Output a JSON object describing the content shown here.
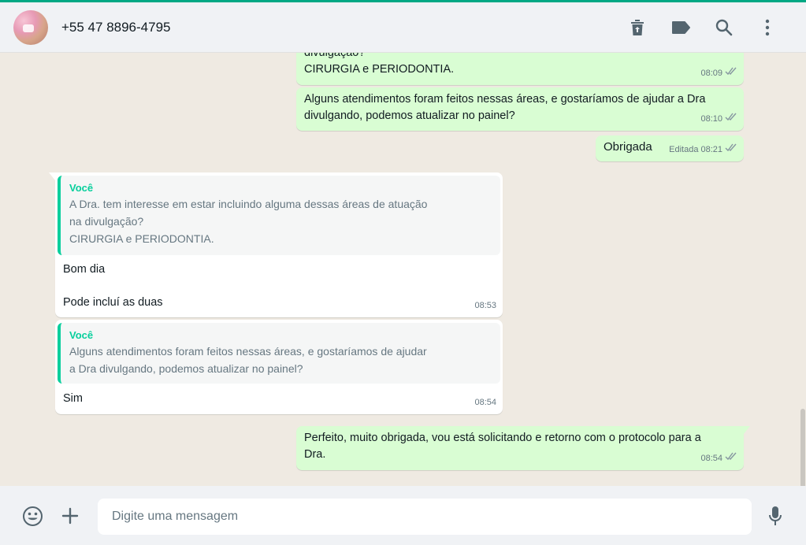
{
  "header": {
    "contact_name": "+55 47 8896-4795",
    "icons": [
      "delete-icon",
      "label-icon",
      "search-icon",
      "menu-icon"
    ]
  },
  "messages": {
    "m1": {
      "lines": [
        "divulgação?",
        "CIRURGIA e PERIODONTIA."
      ],
      "time": "08:09"
    },
    "m2": {
      "lines": [
        "Alguns atendimentos foram feitos nessas áreas, e gostaríamos de ajudar a Dra",
        "divulgando, podemos atualizar no painel?"
      ],
      "time": "08:10"
    },
    "m3": {
      "text": "Obrigada",
      "edited": "Editada",
      "time": "08:21"
    },
    "m4": {
      "quote_author": "Você",
      "quote_lines": [
        "A Dra. tem interesse em estar incluindo alguma dessas áreas de atuação",
        "na divulgação?",
        "CIRURGIA e PERIODONTIA."
      ],
      "lines": [
        "Bom dia",
        "Pode incluí as duas"
      ],
      "time": "08:53"
    },
    "m5": {
      "quote_author": "Você",
      "quote_lines": [
        "Alguns atendimentos foram feitos nessas áreas, e gostaríamos de ajudar",
        "a Dra divulgando, podemos atualizar no painel?"
      ],
      "text": "Sim",
      "time": "08:54"
    },
    "m6": {
      "lines": [
        "Perfeito, muito obrigada, vou está solicitando e retorno com o protocolo para a",
        "Dra."
      ],
      "time": "08:54"
    }
  },
  "composer": {
    "placeholder": "Digite uma mensagem"
  },
  "colors": {
    "accent": "#00a884",
    "outgoing_bubble": "#d9fdd3",
    "incoming_bubble": "#ffffff",
    "quote_bar": "#06cf9c"
  }
}
